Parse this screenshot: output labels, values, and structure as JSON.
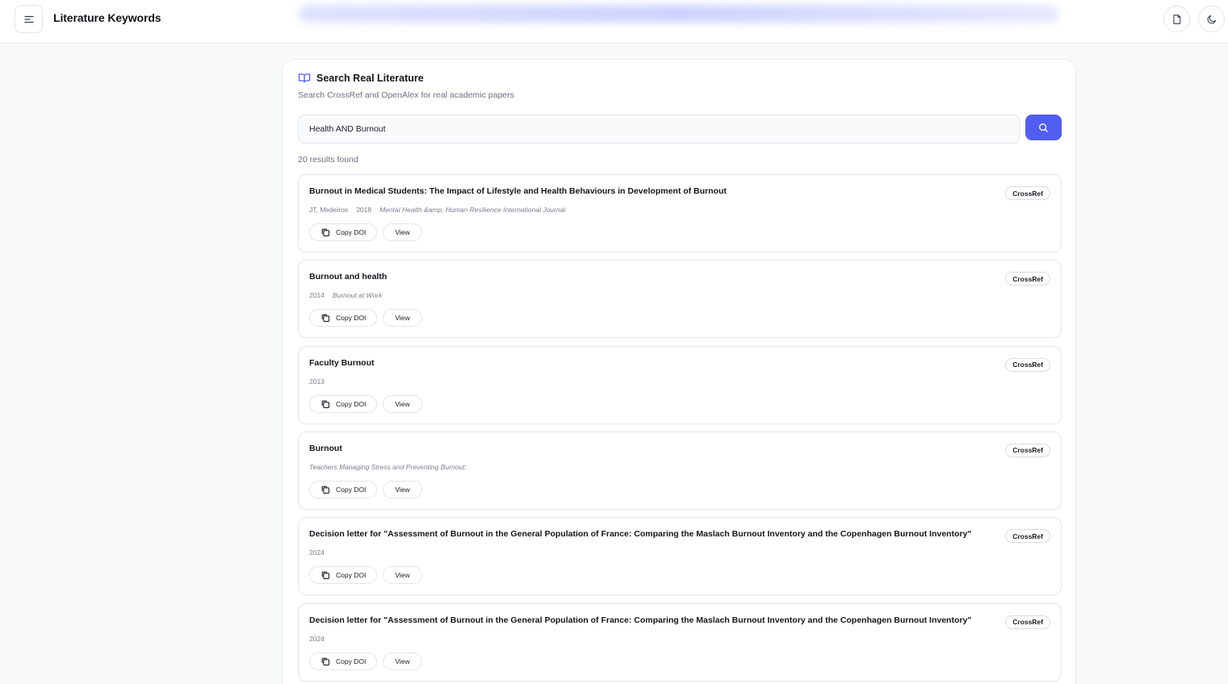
{
  "header": {
    "title": "Literature Keywords"
  },
  "panel": {
    "title": "Search Real Literature",
    "subtitle": "Search CrossRef and OpenAlex for real academic papers"
  },
  "search": {
    "value": "Health AND Burnout",
    "placeholder": ""
  },
  "results": {
    "count_text": "20 results found",
    "copy_label": "Copy DOI",
    "view_label": "View",
    "items": [
      {
        "title": "Burnout in Medical Students: The Impact of Lifestyle and Health Behaviours in Development of Burnout",
        "authors": "JT, Medeiros",
        "year": "2018",
        "journal": "Mental Health &amp; Human Resilience International Journal",
        "source": "CrossRef"
      },
      {
        "title": "Burnout and health",
        "authors": "",
        "year": "2014",
        "journal": "Burnout at Work",
        "source": "CrossRef"
      },
      {
        "title": "Faculty Burnout",
        "authors": "",
        "year": "2013",
        "journal": "",
        "source": "CrossRef"
      },
      {
        "title": "Burnout",
        "authors": "",
        "year": "",
        "journal": "Teachers Managing Stress and Preventing Burnout:",
        "source": "CrossRef"
      },
      {
        "title": "Decision letter for \"Assessment of Burnout in the General Population of France: Comparing the Maslach Burnout Inventory and the Copenhagen Burnout Inventory\"",
        "authors": "",
        "year": "2024",
        "journal": "",
        "source": "CrossRef"
      },
      {
        "title": "Decision letter for \"Assessment of Burnout in the General Population of France: Comparing the Maslach Burnout Inventory and the Copenhagen Burnout Inventory\"",
        "authors": "",
        "year": "2024",
        "journal": "",
        "source": "CrossRef"
      }
    ]
  },
  "icons": {
    "menu": "menu-icon",
    "document": "document-icon",
    "theme": "moon-icon",
    "book": "book-open-icon",
    "search": "search-icon",
    "copy": "copy-icon"
  },
  "colors": {
    "accent": "#4f5ef0",
    "book_icon": "#4f5ef0"
  }
}
